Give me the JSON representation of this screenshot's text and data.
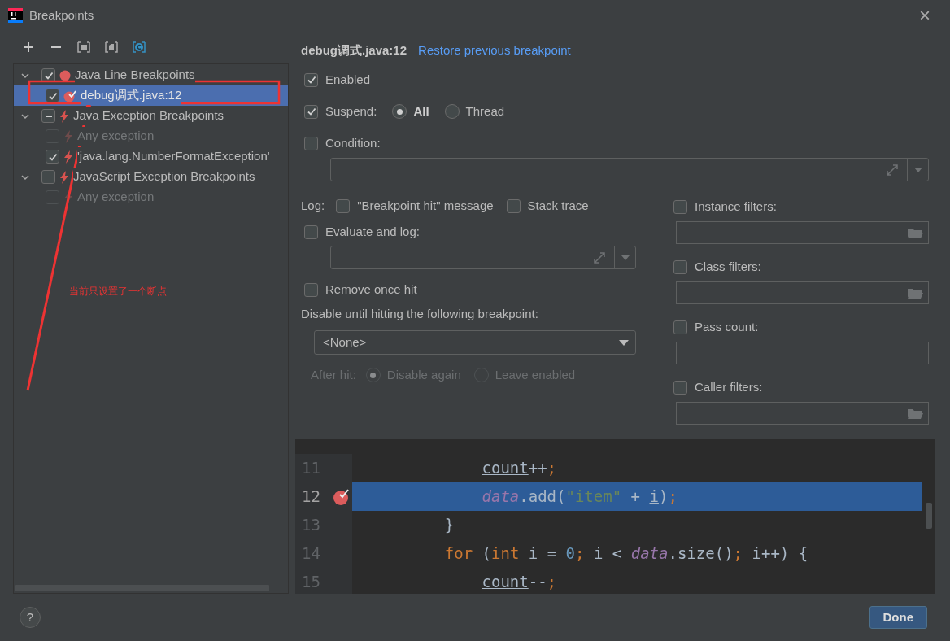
{
  "window": {
    "title": "Breakpoints",
    "close": "×"
  },
  "toolbar": [
    {
      "kind": "add"
    },
    {
      "kind": "remove"
    },
    {
      "kind": "group"
    },
    {
      "kind": "file-group"
    },
    {
      "kind": "class"
    }
  ],
  "tree": [
    {
      "label": "Java Line Breakpoints",
      "kind": "line-group",
      "checked": true,
      "mixed": false,
      "disabled": false,
      "selected": false,
      "expanded": true,
      "children": [
        {
          "label": "debug调式.java:12",
          "kind": "line",
          "checked": true,
          "mixed": false,
          "disabled": false,
          "selected": true
        }
      ]
    },
    {
      "label": "Java Exception Breakpoints",
      "kind": "exception",
      "checked": true,
      "mixed": true,
      "disabled": false,
      "selected": false,
      "expanded": true,
      "children": [
        {
          "label": "Any exception",
          "kind": "exception",
          "checked": false,
          "mixed": false,
          "disabled": true,
          "selected": false
        },
        {
          "label": "'java.lang.NumberFormatException'",
          "kind": "exception",
          "checked": true,
          "mixed": false,
          "disabled": false,
          "selected": false
        }
      ]
    },
    {
      "label": "JavaScript Exception Breakpoints",
      "kind": "exception",
      "checked": false,
      "mixed": false,
      "disabled": false,
      "selected": false,
      "expanded": true,
      "children": [
        {
          "label": "Any exception",
          "kind": "exception",
          "checked": false,
          "mixed": false,
          "disabled": true,
          "selected": false
        }
      ]
    }
  ],
  "annotation": {
    "text": "当前只设置了一个断点"
  },
  "details": {
    "title": "debug调式.java:12",
    "restore_link": "Restore previous breakpoint",
    "enabled": {
      "label": "Enabled",
      "checked": true
    },
    "suspend": {
      "label": "Suspend:",
      "checked": true,
      "options": [
        {
          "label": "All",
          "selected": true
        },
        {
          "label": "Thread",
          "selected": false
        }
      ]
    },
    "condition": {
      "label": "Condition:",
      "checked": false
    },
    "log": {
      "label": "Log:",
      "options": [
        {
          "label": "\"Breakpoint hit\" message",
          "checked": false
        },
        {
          "label": "Stack trace",
          "checked": false
        }
      ]
    },
    "evaluate": {
      "label": "Evaluate and log:",
      "checked": false
    },
    "remove_once_hit": {
      "label": "Remove once hit",
      "checked": false
    },
    "disable_until": {
      "label": "Disable until hitting the following breakpoint:",
      "value": "<None>"
    },
    "after_hit": {
      "label": "After hit:",
      "disabled": true,
      "options": [
        {
          "label": "Disable again",
          "selected": true
        },
        {
          "label": "Leave enabled",
          "selected": false
        }
      ]
    },
    "filters": [
      {
        "label": "Instance filters:",
        "checked": false,
        "browse": true
      },
      {
        "label": "Class filters:",
        "checked": false,
        "browse": true
      },
      {
        "label": "Pass count:",
        "checked": false,
        "browse": false
      },
      {
        "label": "Caller filters:",
        "checked": false,
        "browse": true
      }
    ]
  },
  "code": [
    {
      "number": "11",
      "selected": false,
      "breakpoint": false,
      "tokens": [
        {
          "kind": "var",
          "text": "        count"
        },
        {
          "kind": "plain",
          "text": "++"
        },
        {
          "kind": "punct",
          "text": ";"
        }
      ]
    },
    {
      "number": "12",
      "selected": true,
      "breakpoint": true,
      "tokens": [
        {
          "kind": "field",
          "text": "        data"
        },
        {
          "kind": "plain",
          "text": ".add("
        },
        {
          "kind": "string",
          "text": "\"item\""
        },
        {
          "kind": "plain",
          "text": " + "
        },
        {
          "kind": "var",
          "text": "i"
        },
        {
          "kind": "plain",
          "text": ")"
        },
        {
          "kind": "punct",
          "text": ";"
        }
      ]
    },
    {
      "number": "13",
      "selected": false,
      "breakpoint": false,
      "tokens": [
        {
          "kind": "plain",
          "text": "    }"
        }
      ]
    },
    {
      "number": "14",
      "selected": false,
      "breakpoint": false,
      "tokens": [
        {
          "kind": "keyword",
          "text": "    for"
        },
        {
          "kind": "plain",
          "text": " ("
        },
        {
          "kind": "keyword",
          "text": "int"
        },
        {
          "kind": "var",
          "text": " i"
        },
        {
          "kind": "plain",
          "text": " = "
        },
        {
          "kind": "number",
          "text": "0"
        },
        {
          "kind": "punct",
          "text": ";"
        },
        {
          "kind": "var",
          "text": " i"
        },
        {
          "kind": "plain",
          "text": " < "
        },
        {
          "kind": "field",
          "text": "data"
        },
        {
          "kind": "plain",
          "text": ".size()"
        },
        {
          "kind": "punct",
          "text": ";"
        },
        {
          "kind": "var",
          "text": " i"
        },
        {
          "kind": "plain",
          "text": "++) {"
        }
      ]
    },
    {
      "number": "15",
      "selected": false,
      "breakpoint": false,
      "tokens": [
        {
          "kind": "var",
          "text": "        count"
        },
        {
          "kind": "plain",
          "text": "--"
        },
        {
          "kind": "punct",
          "text": ";"
        }
      ]
    }
  ],
  "footer": {
    "help": "?",
    "done": "Done"
  }
}
